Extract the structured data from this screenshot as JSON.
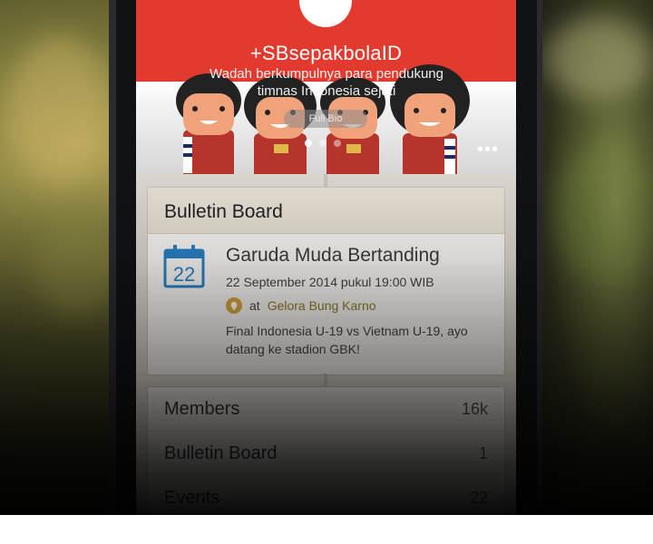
{
  "hero": {
    "title": "+SBsepakbolaID",
    "description": "Wadah berkumpulnya para pendukung timnas Indonesia sejati",
    "bio_button": "Full Bio",
    "carousel_dots": 3,
    "carousel_active_index": 0,
    "more_icon": "more-horizontal-icon"
  },
  "bulletin": {
    "header": "Bulletin Board",
    "event": {
      "calendar_day": "22",
      "title": "Garuda Muda Bertanding",
      "date": "22 September 2014 pukul 19:00 WIB",
      "location_prefix": "at",
      "location": "Gelora Bung Karno",
      "text": "Final Indonesia U-19 vs Vietnam U-19, ayo datang ke stadion GBK!"
    }
  },
  "stats": [
    {
      "label": "Members",
      "value": "16k"
    },
    {
      "label": "Bulletin Board",
      "value": "1"
    },
    {
      "label": "Events",
      "value": "22"
    }
  ],
  "colors": {
    "brand_red": "#e23a2e",
    "calendar_blue": "#2a7fc1",
    "location_gold": "#8a7a26"
  }
}
